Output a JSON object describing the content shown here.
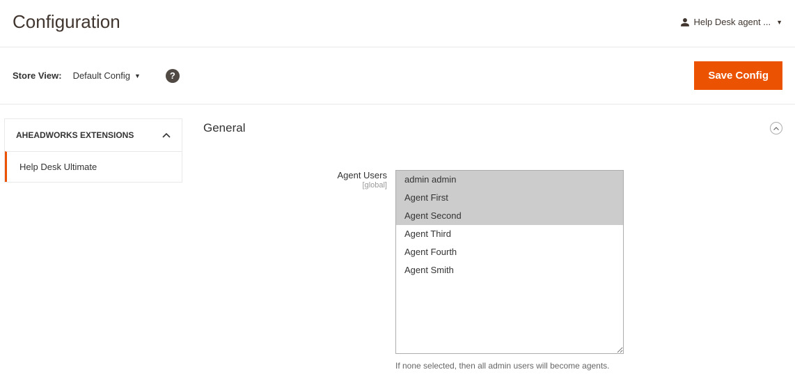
{
  "header": {
    "page_title": "Configuration",
    "user_label": "Help Desk agent ..."
  },
  "control_bar": {
    "store_view_label": "Store View:",
    "store_view_value": "Default Config",
    "save_button_label": "Save Config"
  },
  "sidebar": {
    "group_title": "AHEADWORKS EXTENSIONS",
    "items": [
      {
        "label": "Help Desk Ultimate",
        "active": true
      }
    ]
  },
  "main": {
    "section_title": "General",
    "agent_users": {
      "label": "Agent Users",
      "scope": "[global]",
      "options": [
        {
          "label": "admin admin",
          "selected": true
        },
        {
          "label": "Agent First",
          "selected": true
        },
        {
          "label": "Agent Second",
          "selected": true
        },
        {
          "label": "Agent Third",
          "selected": false
        },
        {
          "label": "Agent Fourth",
          "selected": false
        },
        {
          "label": "Agent Smith",
          "selected": false
        }
      ],
      "note": "If none selected, then all admin users will become agents."
    }
  }
}
